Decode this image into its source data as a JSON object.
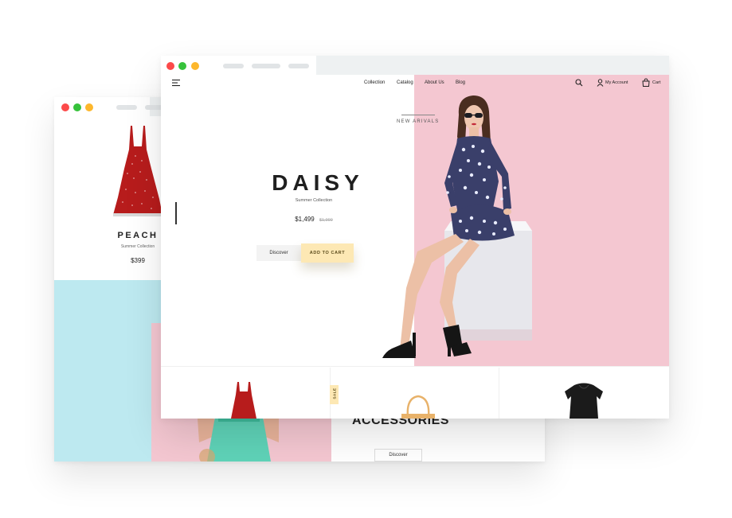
{
  "back_window": {
    "product_title": "PEACH",
    "product_subtitle": "Summer Collection",
    "product_price": "$399",
    "accessories_heading": "ACCESSORIES",
    "discover_label": "Discover"
  },
  "front_window": {
    "nav": {
      "items": [
        "Collection",
        "Catalog",
        "About Us",
        "Blog"
      ],
      "account_label": "My Account",
      "cart_label": "Cart"
    },
    "hero": {
      "tag": "NEW ARIVALS",
      "title": "DAISY",
      "subtitle": "Summer Collection",
      "price": "$1,499",
      "old_price": "$1,999",
      "discover_label": "Discover",
      "cart_label": "ADD TO CART"
    },
    "sale_label": "SALE"
  },
  "colors": {
    "pink_panel": "#f4c7d1",
    "blue_panel": "#bde9f0",
    "accent_yellow": "#fde8b4",
    "chrome_bg": "#eef1f2",
    "traffic_red": "#fc4a4a",
    "traffic_green": "#36c23b",
    "traffic_yellow": "#fdb72c"
  },
  "icons": [
    "menu-icon",
    "search-icon",
    "user-icon",
    "cart-icon"
  ]
}
